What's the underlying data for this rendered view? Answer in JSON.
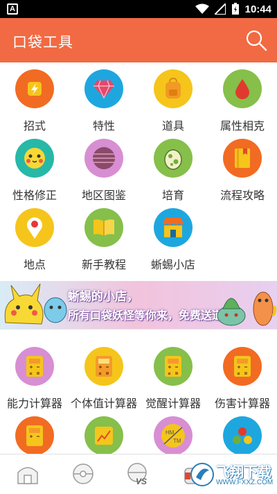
{
  "status_bar": {
    "notification_glyph": "A",
    "time": "10:44",
    "icons": [
      "wifi-icon",
      "signal-icon",
      "battery-icon"
    ]
  },
  "app_bar": {
    "title": "口袋工具",
    "search_icon": "search-icon",
    "color": "#f16a43"
  },
  "tools_top": [
    {
      "label": "招式",
      "icon": "lightning-icon",
      "color": "#f26b22"
    },
    {
      "label": "特性",
      "icon": "gem-icon",
      "color": "#1ea7df"
    },
    {
      "label": "道具",
      "icon": "backpack-icon",
      "color": "#f5c51b"
    },
    {
      "label": "属性相克",
      "icon": "drop-icon",
      "color": "#86bf4a"
    },
    {
      "label": "性格修正",
      "icon": "face-icon",
      "color": "#27b8a8"
    },
    {
      "label": "地区图鉴",
      "icon": "globe-icon",
      "color": "#d88ed3"
    },
    {
      "label": "培育",
      "icon": "egg-icon",
      "color": "#86bf4a"
    },
    {
      "label": "流程攻略",
      "icon": "book-icon",
      "color": "#f26b22"
    },
    {
      "label": "地点",
      "icon": "location-pin-icon",
      "color": "#f5c51b"
    },
    {
      "label": "新手教程",
      "icon": "open-book-icon",
      "color": "#86bf4a"
    },
    {
      "label": "蜥蜴小店",
      "icon": "shop-icon",
      "color": "#1ea7df"
    }
  ],
  "banner": {
    "line1": "蜥蜴的小店，",
    "line2": "所有口袋妖怪等你来，免费送道具"
  },
  "tools_calc": [
    {
      "label": "能力计算器",
      "icon": "calculator-icon",
      "color": "#d88ed3"
    },
    {
      "label": "个体值计算器",
      "icon": "calculator-icon",
      "color": "#f5c51b"
    },
    {
      "label": "觉醒计算器",
      "icon": "calculator-icon",
      "color": "#86bf4a"
    },
    {
      "label": "伤害计算器",
      "icon": "calculator-icon",
      "color": "#f26b22"
    },
    {
      "label": "",
      "icon": "calculator-icon",
      "color": "#f26b22"
    },
    {
      "label": "",
      "icon": "chart-icon",
      "color": "#86bf4a"
    },
    {
      "label": "",
      "icon": "hm-tm-icon",
      "color": "#d88ed3",
      "text_hm": "HM",
      "text_tm": "TM"
    },
    {
      "label": "",
      "icon": "berries-icon",
      "color": "#1ea7df"
    }
  ],
  "bottom_nav": {
    "items": [
      "home-icon",
      "pokeball-icon",
      "versus-icon",
      "bag-icon"
    ],
    "vs_text": "VS"
  },
  "watermark": {
    "text": "飞翔下载",
    "url": "WWW.FXXZ.COM"
  }
}
